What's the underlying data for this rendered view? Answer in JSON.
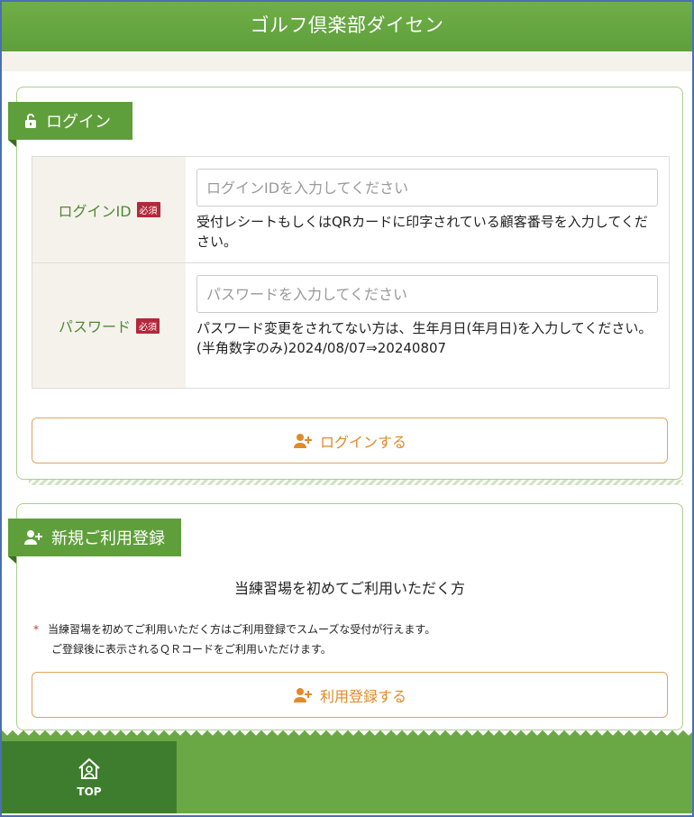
{
  "header": {
    "title": "ゴルフ倶楽部ダイセン"
  },
  "login": {
    "section_title": "ログイン",
    "id_label": "ログインID",
    "required": "必須",
    "id_placeholder": "ログインIDを入力してください",
    "id_hint": "受付レシートもしくはQRカードに印字されている顧客番号を入力してください。",
    "password_label": "パスワード",
    "password_placeholder": "パスワードを入力してください",
    "password_hint_1": "パスワード変更をされてない方は、生年月日(年月日)を入力してください。",
    "password_hint_2": "(半角数字のみ)2024/08/07⇒20240807",
    "button": "ログインする"
  },
  "register": {
    "section_title": "新規ご利用登録",
    "heading": "当練習場を初めてご利用いただく方",
    "note_mark": "*",
    "note_1": "当練習場を初めてご利用いただく方はご利用登録でスムーズな受付が行えます。",
    "note_2": "ご登録後に表示されるＱＲコードをご利用いただけます。",
    "button": "利用登録する"
  },
  "footer": {
    "top_label": "TOP"
  },
  "colors": {
    "green": "#5f9f3b",
    "accent": "#e08a2b",
    "required": "#b3283b"
  }
}
